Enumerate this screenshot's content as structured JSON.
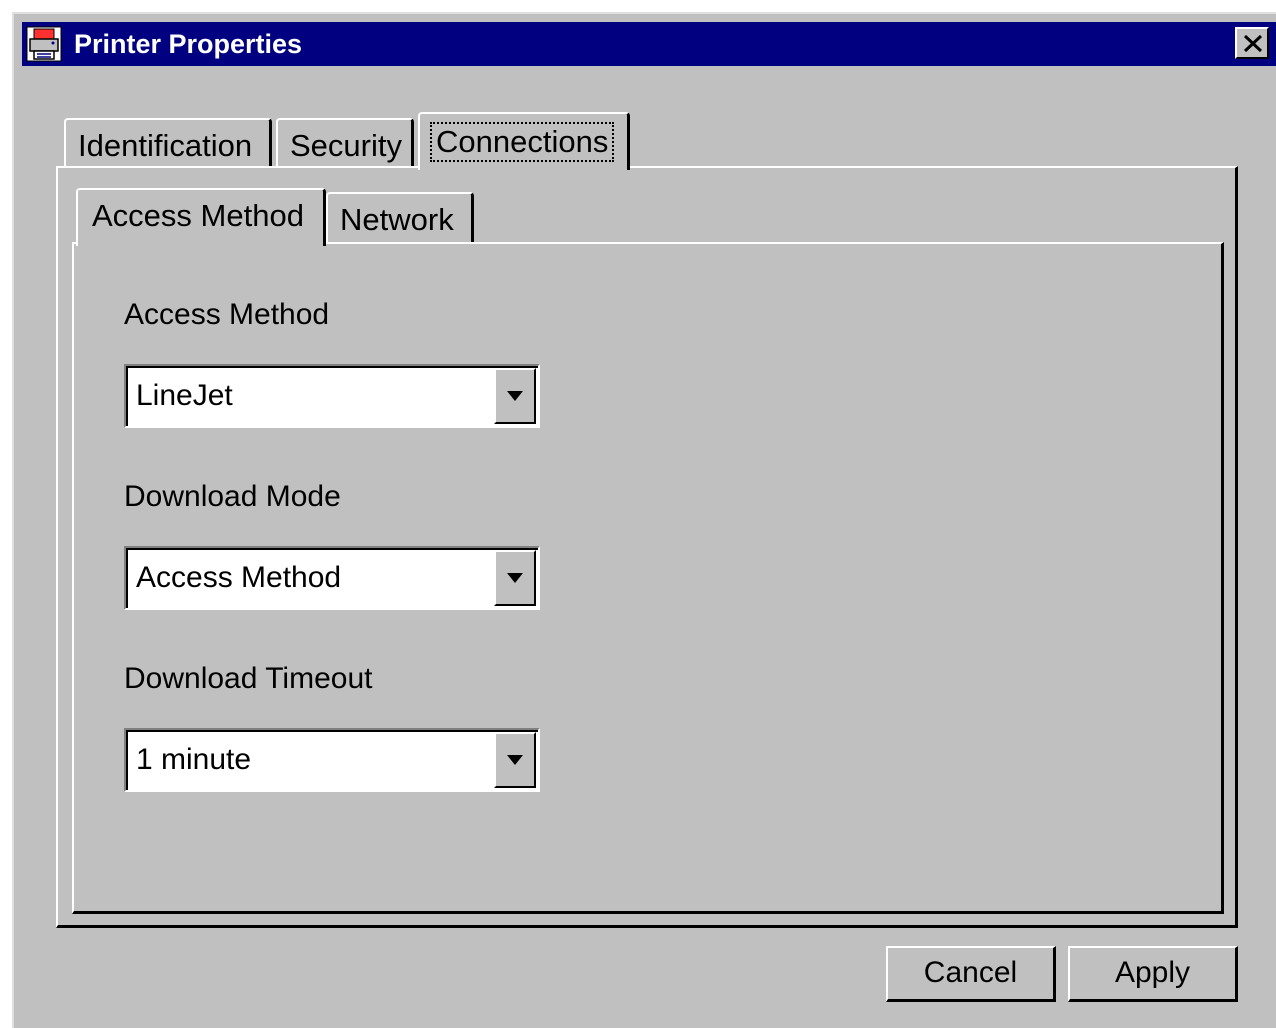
{
  "window": {
    "title": "Printer Properties",
    "app_icon": "printer-app-icon",
    "close_icon": "close-x-icon"
  },
  "tabs": [
    {
      "label": "Identification",
      "selected": false
    },
    {
      "label": "Security",
      "selected": false
    },
    {
      "label": "Connections",
      "selected": true
    }
  ],
  "subtabs": [
    {
      "label": "Access Method",
      "selected": true
    },
    {
      "label": "Network",
      "selected": false
    }
  ],
  "form": {
    "access_method": {
      "label": "Access Method",
      "value": "LineJet"
    },
    "download_mode": {
      "label": "Download Mode",
      "value": "Access Method"
    },
    "download_timeout": {
      "label": "Download Timeout",
      "value": "1 minute"
    }
  },
  "buttons": {
    "cancel": "Cancel",
    "apply": "Apply"
  },
  "colors": {
    "titlebar": "#000080",
    "face": "#c0c0c0",
    "field": "#ffffff"
  }
}
